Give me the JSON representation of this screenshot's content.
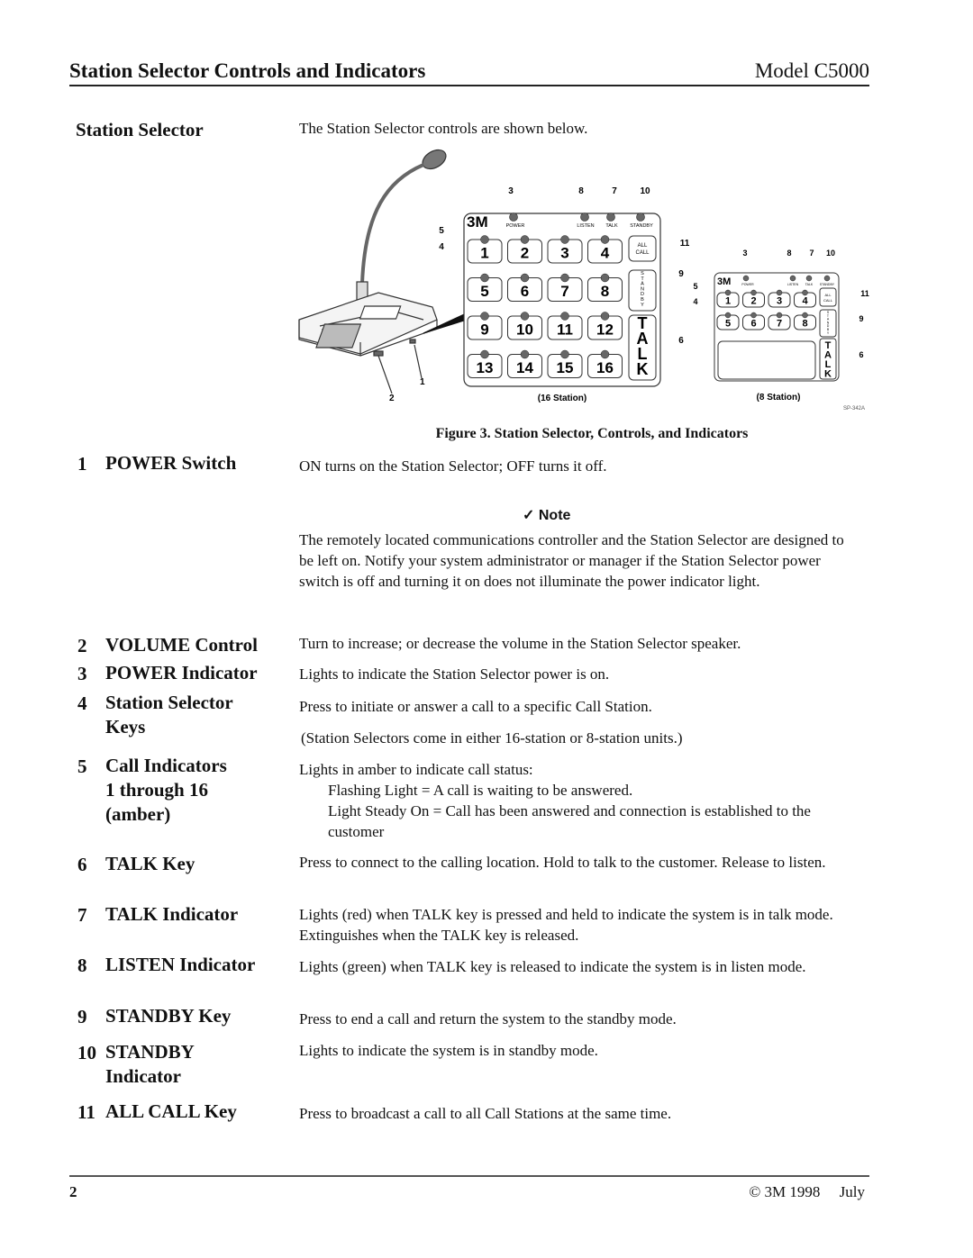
{
  "header": {
    "title": "Station Selector Controls and Indicators",
    "model": "Model C5000"
  },
  "section": {
    "heading": "Station Selector",
    "intro": "The Station Selector controls are shown below."
  },
  "figure": {
    "caption": "Figure 3. Station Selector, Controls, and Indicators",
    "ref_code": "SP-342A",
    "panel16": {
      "label": "(16 Station)",
      "brand": "3M",
      "indicator_labels": [
        "POWER",
        "LISTEN",
        "TALK",
        "STANDBY"
      ],
      "keys": [
        "1",
        "2",
        "3",
        "4",
        "5",
        "6",
        "7",
        "8",
        "9",
        "10",
        "11",
        "12",
        "13",
        "14",
        "15",
        "16"
      ],
      "all_call_line1": "ALL",
      "all_call_line2": "CALL",
      "standby_vertical": "STANDBY",
      "talk_vertical": "TALK",
      "callouts": {
        "top": [
          "3",
          "8",
          "7",
          "10"
        ],
        "left": [
          "5",
          "4"
        ],
        "right": [
          "11",
          "9",
          "6"
        ],
        "device": [
          "1",
          "2"
        ]
      }
    },
    "panel8": {
      "label": "(8 Station)",
      "brand": "3M",
      "indicator_labels": [
        "POWER",
        "LISTEN",
        "TALK",
        "STANDBY"
      ],
      "keys": [
        "1",
        "2",
        "3",
        "4",
        "5",
        "6",
        "7",
        "8"
      ],
      "all_call_line1": "ALL",
      "all_call_line2": "CALL",
      "standby_vertical": "STANDBY",
      "talk_vertical": "TALK",
      "callouts": {
        "top": [
          "3",
          "8",
          "7",
          "10"
        ],
        "left": [
          "5",
          "4"
        ],
        "right": [
          "11",
          "9",
          "6"
        ]
      }
    }
  },
  "items": [
    {
      "num": "1",
      "label": "POWER Switch",
      "text": "ON turns on the Station Selector; OFF turns it off."
    },
    {
      "num": "2",
      "label": "VOLUME Control",
      "text": "Turn to increase; or decrease the volume in the Station Selector speaker."
    },
    {
      "num": "3",
      "label": "POWER Indicator",
      "text": "Lights to indicate the Station Selector power is on."
    },
    {
      "num": "4",
      "label_line1": "Station Selector",
      "label_line2": "Keys",
      "text": "Press to initiate or answer a call to a specific Call Station.",
      "text2": " (Station Selectors come in either 16-station or 8-station units.)"
    },
    {
      "num": "5",
      "label_line1": "Call Indicators",
      "label_line2": "1 through 16",
      "label_line3": "(amber)",
      "text": "Lights in amber to indicate call status:",
      "sub1": "Flashing Light = A call is waiting to be answered.",
      "sub2": "Light Steady On = Call has been answered and connection is established to the customer"
    },
    {
      "num": "6",
      "label": "TALK Key",
      "text": "Press to connect to the calling location.  Hold to talk to the customer.  Release to listen."
    },
    {
      "num": "7",
      "label": "TALK Indicator",
      "text": "Lights (red) when TALK key is pressed and held to indicate the system is in talk mode.  Extinguishes when the TALK key is released."
    },
    {
      "num": "8",
      "label": "LISTEN Indicator",
      "text": "Lights (green) when TALK key is released to indicate the system is in listen mode."
    },
    {
      "num": "9",
      "label": "STANDBY Key",
      "text": "Press to end a call and return the system to the standby mode."
    },
    {
      "num": "10",
      "label_line1": "STANDBY",
      "label_line2": "Indicator",
      "text": "Lights to indicate the system is in standby mode."
    },
    {
      "num": "11",
      "label": "ALL CALL Key",
      "text": "Press to broadcast a call to all Call Stations at the same time."
    }
  ],
  "note": {
    "icon": "checkmark-icon",
    "glyph": "✓",
    "title": "Note",
    "text": "The remotely located communications controller and the Station Selector are designed to be left on.   Notify your system administrator or manager if the Station Selector power switch is off and turning it on does not illuminate the power indicator light."
  },
  "footer": {
    "page_number": "2",
    "copyright": "© 3M 1998     July"
  }
}
